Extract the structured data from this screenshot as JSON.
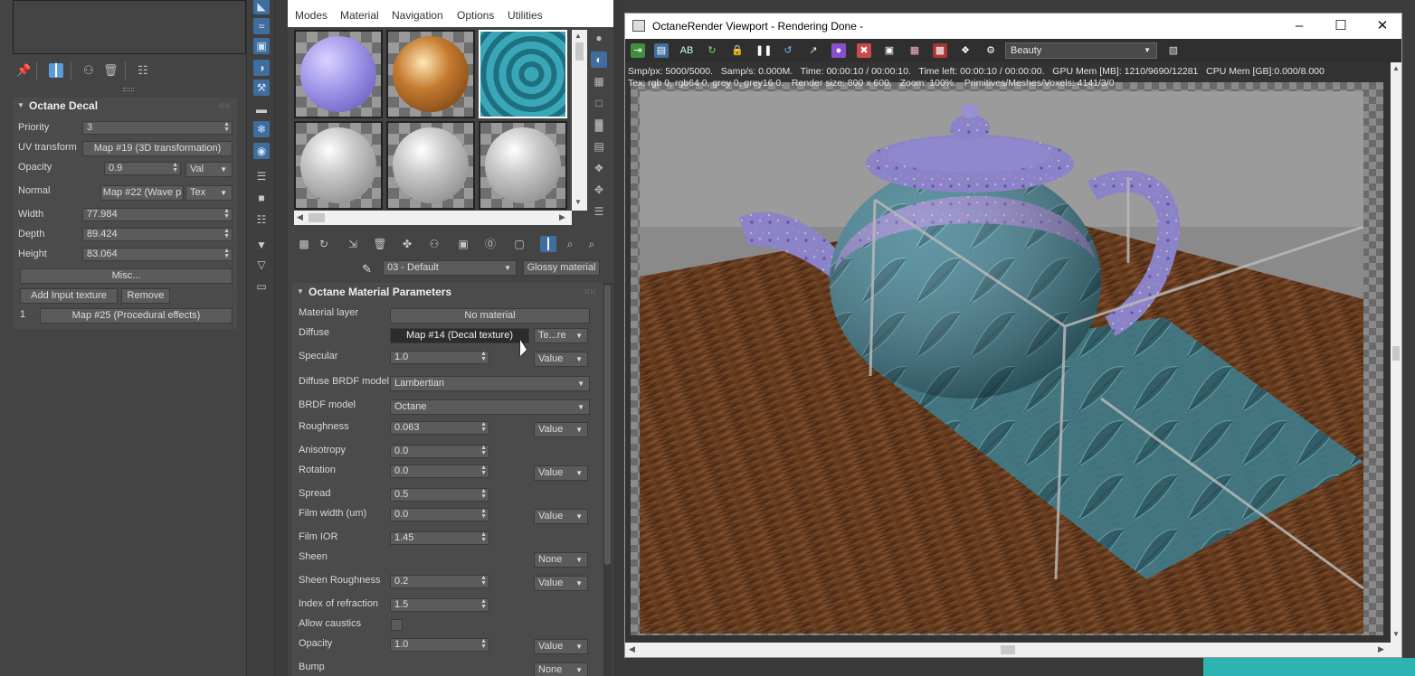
{
  "decal_panel": {
    "rollout_title": "Octane Decal",
    "priority_label": "Priority",
    "priority_value": "3",
    "uv_label": "UV transform",
    "uv_value": "Map #19 (3D transformation)",
    "opacity_label": "Opacity",
    "opacity_value": "0.9",
    "opacity_mode": "Val",
    "normal_label": "Normal",
    "normal_value": "Map #22 (Wave p",
    "normal_mode": "Tex",
    "width_label": "Width",
    "width_value": "77.984",
    "depth_label": "Depth",
    "depth_value": "89.424",
    "height_label": "Height",
    "height_value": "83.064",
    "misc_button": "Misc...",
    "add_input_button": "Add Input texture",
    "remove_button": "Remove",
    "input_index": "1",
    "input_map": "Map #25 (Procedural effects)"
  },
  "material_editor": {
    "menu": [
      "Modes",
      "Material",
      "Navigation",
      "Options",
      "Utilities"
    ],
    "material_name": "03 - Default",
    "material_type": "Glossy material",
    "rollout_title": "Octane Material Parameters",
    "params": {
      "material_layer": {
        "label": "Material layer",
        "value": "No material"
      },
      "diffuse": {
        "label": "Diffuse",
        "value": "Map #14 (Decal texture)",
        "mode": "Te...re"
      },
      "specular": {
        "label": "Specular",
        "value": "1.0",
        "mode": "Value"
      },
      "diffuse_brdf": {
        "label": "Diffuse BRDF model",
        "value": "Lambertian"
      },
      "brdf": {
        "label": "BRDF model",
        "value": "Octane"
      },
      "roughness": {
        "label": "Roughness",
        "value": "0.063",
        "mode": "Value"
      },
      "anisotropy": {
        "label": "Anisotropy",
        "value": "0.0"
      },
      "rotation": {
        "label": "Rotation",
        "value": "0.0",
        "mode": "Value"
      },
      "spread": {
        "label": "Spread",
        "value": "0.5"
      },
      "film_width": {
        "label": "Film width (um)",
        "value": "0.0",
        "mode": "Value"
      },
      "film_ior": {
        "label": "Film IOR",
        "value": "1.45"
      },
      "sheen": {
        "label": "Sheen",
        "mode": "None"
      },
      "sheen_roughness": {
        "label": "Sheen Roughness",
        "value": "0.2",
        "mode": "Value"
      },
      "ior": {
        "label": "Index of refraction",
        "value": "1.5"
      },
      "allow_caustics": {
        "label": "Allow caustics"
      },
      "opacity": {
        "label": "Opacity",
        "value": "1.0",
        "mode": "Value"
      },
      "bump": {
        "label": "Bump",
        "mode": "None"
      }
    }
  },
  "viewport": {
    "title": "OctaneRender Viewport - Rendering Done -",
    "pass": "Beauty",
    "stats_line1": "Smp/px: 5000/5000.   Samp/s: 0.000M.   Time: 00:00:10 / 00:00:10.   Time left: 00:00:10 / 00:00:00.   GPU Mem [MB]: 1210/9690/12281   CPU Mem [GB]:0.000/8.000",
    "stats_line2": "Tex: rgb 0, rgb64 0, grey 0, grey16 0.   Render size: 800 x 600.   Zoom: 100%.   Primitives/Meshes/Voxels: 4141/3/0"
  },
  "colors": {
    "accent_blue": "#5a9bd8",
    "panel_bg": "#444444",
    "wood": "#6b3f22",
    "teapot_purple": "#8c82c8",
    "decal_teal": "#3d7f90"
  }
}
